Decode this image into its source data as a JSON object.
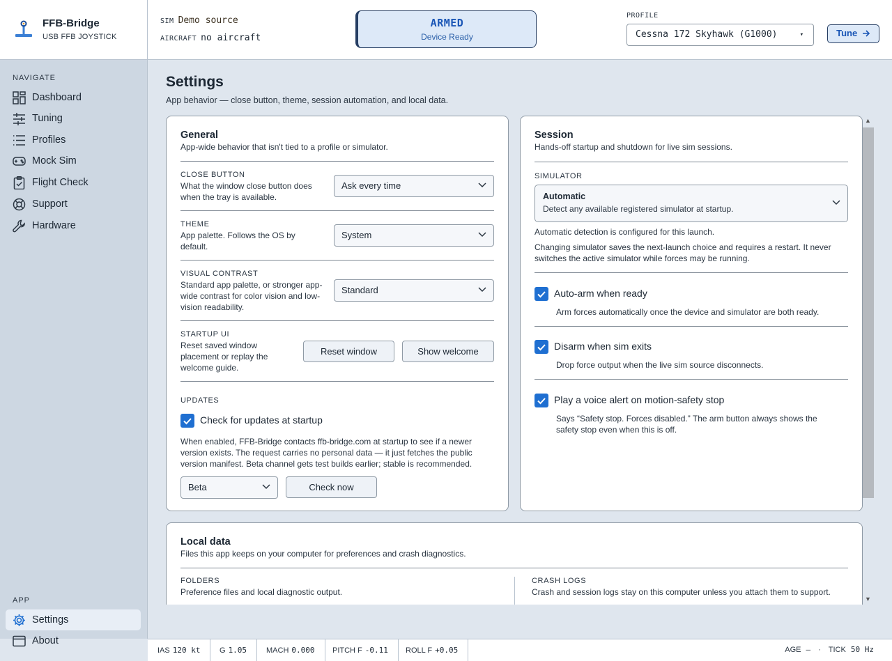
{
  "brand": {
    "name": "FFB-Bridge",
    "subtitle": "USB FFB JOYSTICK"
  },
  "header": {
    "sim_label": "SIM",
    "sim_value": "Demo source",
    "aircraft_label": "AIRCRAFT",
    "aircraft_value": "no aircraft",
    "status_title": "ARMED",
    "status_sub": "Device Ready",
    "profile_label": "PROFILE",
    "profile_value": "Cessna 172 Skyhawk (G1000)",
    "tune_label": "Tune"
  },
  "sidebar": {
    "nav_heading": "NAVIGATE",
    "items": [
      {
        "label": "Dashboard",
        "icon": "dashboard-icon"
      },
      {
        "label": "Tuning",
        "icon": "sliders-icon"
      },
      {
        "label": "Profiles",
        "icon": "list-icon"
      },
      {
        "label": "Mock Sim",
        "icon": "gamepad-icon"
      },
      {
        "label": "Flight Check",
        "icon": "clipboard-check-icon"
      },
      {
        "label": "Support",
        "icon": "lifebuoy-icon"
      },
      {
        "label": "Hardware",
        "icon": "wrench-icon"
      }
    ],
    "app_heading": "APP",
    "app_items": [
      {
        "label": "Settings",
        "icon": "gear-icon",
        "active": true
      },
      {
        "label": "About",
        "icon": "window-icon"
      }
    ]
  },
  "page": {
    "title": "Settings",
    "subtitle": "App behavior — close button, theme, session automation, and local data."
  },
  "general": {
    "title": "General",
    "subtitle": "App-wide behavior that isn't tied to a profile or simulator.",
    "close_button": {
      "label": "CLOSE BUTTON",
      "desc": "What the window close button does when the tray is available.",
      "value": "Ask every time"
    },
    "theme": {
      "label": "THEME",
      "desc": "App palette. Follows the OS by default.",
      "value": "System"
    },
    "visual_contrast": {
      "label": "VISUAL CONTRAST",
      "desc": "Standard app palette, or stronger app-wide contrast for color vision and low-vision readability.",
      "value": "Standard"
    },
    "startup_ui": {
      "label": "STARTUP UI",
      "desc": "Reset saved window placement or replay the welcome guide.",
      "reset_label": "Reset window",
      "welcome_label": "Show welcome"
    },
    "updates": {
      "label": "UPDATES",
      "check_label": "Check for updates at startup",
      "checked": true,
      "desc": "When enabled, FFB-Bridge contacts ffb-bridge.com at startup to see if a newer version exists. The request carries no personal data — it just fetches the public version manifest. Beta channel gets test builds earlier; stable is recommended.",
      "channel": "Beta",
      "check_now_label": "Check now"
    }
  },
  "session": {
    "title": "Session",
    "subtitle": "Hands-off startup and shutdown for live sim sessions.",
    "simulator_label": "SIMULATOR",
    "simulator_value": "Automatic",
    "simulator_value_desc": "Detect any available registered simulator at startup.",
    "note1": "Automatic detection is configured for this launch.",
    "note2": "Changing simulator saves the next-launch choice and requires a restart. It never switches the active simulator while forces may be running.",
    "options": [
      {
        "label": "Auto-arm when ready",
        "desc": "Arm forces automatically once the device and simulator are both ready.",
        "checked": true
      },
      {
        "label": "Disarm when sim exits",
        "desc": "Drop force output when the live sim source disconnects.",
        "checked": true
      },
      {
        "label": "Play a voice alert on motion-safety stop",
        "desc": "Says “Safety stop. Forces disabled.” The arm button always shows the safety stop even when this is off.",
        "checked": true
      }
    ]
  },
  "local_data": {
    "title": "Local data",
    "subtitle": "Files this app keeps on your computer for preferences and crash diagnostics.",
    "folders_label": "FOLDERS",
    "folders_desc": "Preference files and local diagnostic output.",
    "crash_label": "CRASH LOGS",
    "crash_desc": "Crash and session logs stay on this computer unless you attach them to support."
  },
  "statusbar": {
    "ias_label": "IAS",
    "ias_value": "120 kt",
    "g_label": "G",
    "g_value": "1.05",
    "mach_label": "MACH",
    "mach_value": "0.000",
    "pitch_label": "PITCH F",
    "pitch_value": "-0.11",
    "roll_label": "ROLL F",
    "roll_value": "+0.05",
    "age_label": "AGE",
    "age_value": "—",
    "dot": "·",
    "tick_label": "TICK",
    "tick_value": "50 Hz"
  },
  "colors": {
    "accent": "#1f6fd1",
    "armed_bg": "#dde9f8",
    "armed_border": "#263e63",
    "sidebar_bg": "#cdd7e2",
    "content_bg": "#dfe6ee"
  }
}
